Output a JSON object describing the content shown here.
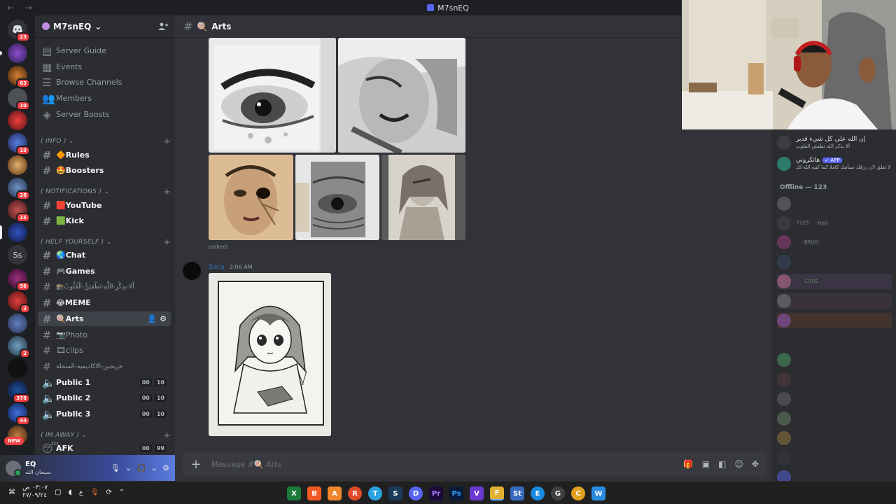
{
  "window": {
    "title": "M7snEQ",
    "nav": "←  →"
  },
  "servers": {
    "badges": [
      "23",
      "63",
      "10",
      "19",
      "28",
      "15",
      "56",
      "2",
      "2",
      "378",
      "44"
    ],
    "ss_label": "Ss",
    "new_label": "NEW"
  },
  "guild": {
    "name": "M7snEQ",
    "chevron": "⌄"
  },
  "sidebar": {
    "top_items": [
      {
        "label": "Server Guide",
        "icon": "guide-icon"
      },
      {
        "label": "Events",
        "icon": "calendar-icon"
      },
      {
        "label": "Browse Channels",
        "icon": "browse-icon"
      },
      {
        "label": "Members",
        "icon": "members-icon"
      },
      {
        "label": "Server Boosts",
        "icon": "boost-icon"
      }
    ],
    "categories": [
      "( INFO )",
      "( NOTIFICATIONS )",
      "( HELP YOURSELF )",
      "( IM AWAY )"
    ],
    "channels": [
      {
        "label": "Rules",
        "emoji": "🔶",
        "bold": true
      },
      {
        "label": "Boosters",
        "emoji": "🤩",
        "bold": true
      },
      {
        "label": "YouTube",
        "emoji": "🟥",
        "bold": true
      },
      {
        "label": "Kick",
        "emoji": "🟩",
        "bold": true
      },
      {
        "label": "Chat",
        "emoji": "🌏",
        "bold": true
      },
      {
        "label": "Games",
        "emoji": "🎮",
        "bold": true
      },
      {
        "label": "أَلَا-بِذِكْرِ-اللَّهِ-تَطْمَئِنُّ-الْقُلُوبُ",
        "emoji": "🕋",
        "bold": false
      },
      {
        "label": "MEME",
        "emoji": "😂",
        "bold": true
      },
      {
        "label": "Arts",
        "emoji": "🍭",
        "bold": true,
        "active": true
      },
      {
        "label": "Photo",
        "emoji": "📷",
        "bold": false
      },
      {
        "label": "clips",
        "emoji": "🎞",
        "bold": false
      },
      {
        "label": "خريجين-الاكاديمية-المنحلة",
        "emoji": "",
        "bold": false
      }
    ],
    "voice": [
      {
        "label": "Public 1",
        "a": "00",
        "b": "10"
      },
      {
        "label": "Public 2",
        "a": "00",
        "b": "10"
      },
      {
        "label": "Public 3",
        "a": "00",
        "b": "10"
      },
      {
        "label": "AFK",
        "a": "00",
        "b": "99"
      }
    ]
  },
  "user": {
    "name": "EQ",
    "status": "سبحان الله"
  },
  "channel": {
    "name": "Arts",
    "emoji": "🍭"
  },
  "messages": {
    "edited_label": "(edited)",
    "author": "Sara",
    "time": "3:06 AM"
  },
  "composer": {
    "placeholder": "Message #🍭 Arts"
  },
  "members": {
    "online": [
      {
        "name": "إن الله على كل شيء قدير",
        "sub": "ألا بذكر الله تطمئن القلوب"
      },
      {
        "name": "هاتكروني",
        "sub": "لا تقلق لان رزقك سيأتيك كاملا كما كتبه الله لك",
        "badge": "✓ APP"
      }
    ],
    "offline_header": "Offline — 123",
    "offline": [
      {
        "name": "",
        "tag": ""
      },
      {
        "name": "Feth",
        "tag": "Hell"
      },
      {
        "name": "",
        "tag": "BRUH"
      },
      {
        "name": "",
        "tag": ""
      },
      {
        "name": "",
        "tag": "CODE"
      },
      {
        "name": "",
        "tag": ""
      },
      {
        "name": "",
        "tag": ""
      },
      {
        "name": "",
        "tag": ""
      },
      {
        "name": "",
        "tag": ""
      },
      {
        "name": "",
        "tag": ""
      },
      {
        "name": "",
        "tag": ""
      },
      {
        "name": "",
        "tag": ""
      },
      {
        "name": "",
        "tag": ""
      },
      {
        "name": "",
        "tag": ""
      },
      {
        "name": "",
        "tag": ""
      }
    ]
  },
  "taskbar": {
    "clock_time": "٠٣:٠٧ ص",
    "clock_date": "٢٧/٠٩/٢٤",
    "lang": "ع",
    "apps": [
      "X",
      "B",
      "A",
      "R",
      "T",
      "S",
      "D",
      "Pr",
      "Ps",
      "V",
      "F",
      "St",
      "E",
      "G",
      "C",
      "W"
    ]
  },
  "colors": {
    "accent": "#5865f2",
    "bg_app": "#313338",
    "bg_sidebar": "#2b2d31",
    "bg_servers": "#1e1f22",
    "danger": "#f23f43",
    "online": "#23a55a"
  }
}
